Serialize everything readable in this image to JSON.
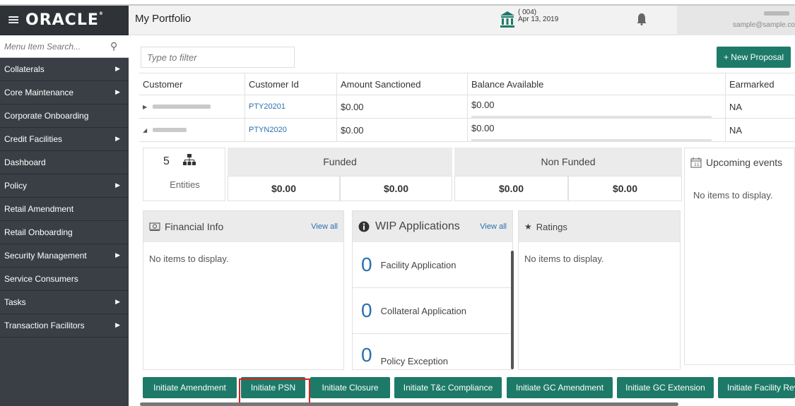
{
  "brand": {
    "logo_text": "ORACLE",
    "menu_icon": "hamburger-icon"
  },
  "sidebar": {
    "search_placeholder": "Menu Item Search...",
    "items": [
      {
        "label": "Collaterals",
        "has_submenu": true
      },
      {
        "label": "Core Maintenance",
        "has_submenu": true
      },
      {
        "label": "Corporate Onboarding",
        "has_submenu": false
      },
      {
        "label": "Credit Facilities",
        "has_submenu": true
      },
      {
        "label": "Dashboard",
        "has_submenu": false
      },
      {
        "label": "Policy",
        "has_submenu": true
      },
      {
        "label": "Retail Amendment",
        "has_submenu": false
      },
      {
        "label": "Retail Onboarding",
        "has_submenu": false
      },
      {
        "label": "Security Management",
        "has_submenu": true
      },
      {
        "label": "Service Consumers",
        "has_submenu": false
      },
      {
        "label": "Tasks",
        "has_submenu": true
      },
      {
        "label": "Transaction Facilitors",
        "has_submenu": true
      }
    ]
  },
  "header": {
    "title": "My Portfolio",
    "branch_code": "( 004)",
    "date": "Apr 13, 2019",
    "user_email": "sample@sample.co"
  },
  "filter": {
    "placeholder": "Type to filter"
  },
  "new_proposal_label": "+ New Proposal",
  "table": {
    "headers": [
      "Customer",
      "Customer Id",
      "Amount Sanctioned",
      "Balance Available",
      "Earmarked"
    ],
    "rows": [
      {
        "expander": "▶",
        "customer_id": "PTY20201",
        "amount_sanctioned": "$0.00",
        "balance_available": "$0.00",
        "earmarked": "NA"
      },
      {
        "expander": "◢",
        "customer_id": "PTYN2020",
        "amount_sanctioned": "$0.00",
        "balance_available": "$0.00",
        "earmarked": "NA"
      }
    ]
  },
  "summary": {
    "entities_count": "5",
    "entities_label": "Entities",
    "funded_label": "Funded",
    "non_funded_label": "Non Funded",
    "funded_values": [
      "$0.00",
      "$0.00"
    ],
    "non_funded_values": [
      "$0.00",
      "$0.00"
    ],
    "upcoming_label": "Upcoming events",
    "upcoming_empty": "No items to display."
  },
  "financial_info": {
    "title": "Financial Info",
    "view_all": "View all",
    "empty": "No items to display."
  },
  "wip": {
    "title": "WIP Applications",
    "view_all": "View all",
    "items": [
      {
        "count": "0",
        "label": "Facility Application"
      },
      {
        "count": "0",
        "label": "Collateral Application"
      },
      {
        "count": "0",
        "label": "Policy Exception"
      }
    ]
  },
  "ratings": {
    "title": "Ratings",
    "empty": "No items to display."
  },
  "actions": [
    "Initiate Amendment",
    "Initiate PSN",
    "Initiate Closure",
    "Initiate T&c Compliance",
    "Initiate GC Amendment",
    "Initiate GC Extension",
    "Initiate Facility Revi"
  ],
  "colors": {
    "accent": "#1d7a68",
    "sidebar": "#3a3f45",
    "link": "#2a6fb0",
    "highlight": "#e02020"
  }
}
